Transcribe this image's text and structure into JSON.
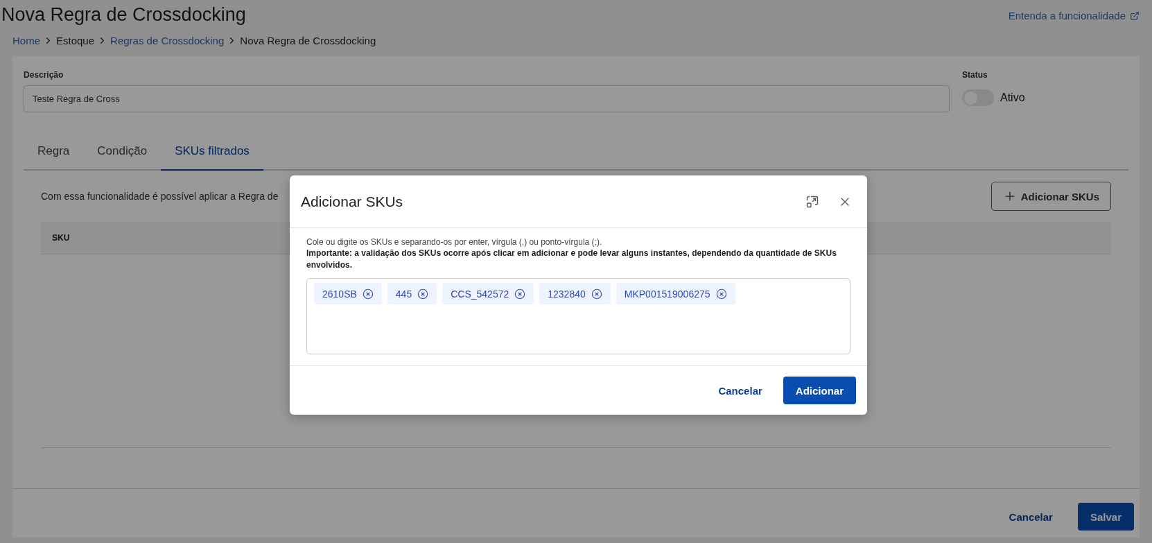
{
  "page": {
    "title": "Nova Regra de Crossdocking",
    "help_link": "Entenda a funcionalidade"
  },
  "breadcrumb": [
    {
      "label": "Home",
      "link": true
    },
    {
      "label": "Estoque",
      "link": false
    },
    {
      "label": "Regras de Crossdocking",
      "link": true
    },
    {
      "label": "Nova Regra de Crossdocking",
      "link": false
    }
  ],
  "form": {
    "description": {
      "label": "Descrição",
      "value": "Teste Regra de Cross"
    },
    "status": {
      "label": "Status",
      "on": false,
      "text": "Ativo"
    }
  },
  "tabs": [
    {
      "label": "Regra",
      "selected": false
    },
    {
      "label": "Condição",
      "selected": false
    },
    {
      "label": "SKUs filtrados",
      "selected": true
    }
  ],
  "sku_tab": {
    "intro": "Com essa funcionalidade é possível aplicar a Regra de",
    "add_button": "Adicionar SKUs",
    "columns": [
      "SKU"
    ]
  },
  "footer": {
    "cancel": "Cancelar",
    "save": "Salvar"
  },
  "modal": {
    "title": "Adicionar SKUs",
    "hint": "Cole ou digite os SKUs e separando-os por enter, vírgula (,) ou ponto-vírgula (;).",
    "note": "Importante: a validação dos SKUs ocorre após clicar em adicionar e pode levar alguns instantes, dependendo da quantidade de SKUs envolvidos.",
    "skus": [
      "2610SB",
      "445",
      "CCS_542572",
      "1232840",
      "MKP001519006275"
    ],
    "cancel": "Cancelar",
    "confirm": "Adicionar"
  }
}
